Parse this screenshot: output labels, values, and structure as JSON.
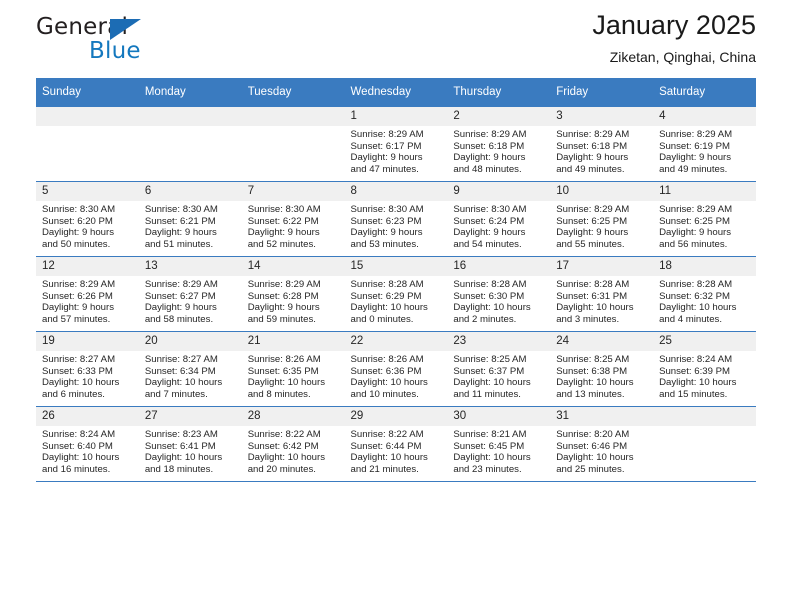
{
  "brand": {
    "name_top": "General",
    "name_bottom": "Blue",
    "triangle_color": "#1c6cb4",
    "blue_text_color": "#1478be"
  },
  "header": {
    "title": "January 2025",
    "location": "Ziketan, Qinghai, China"
  },
  "theme": {
    "header_bar_color": "#3a7bc0",
    "daynum_bg": "#f0f0f0",
    "text_color": "#262626"
  },
  "weekdays": [
    "Sunday",
    "Monday",
    "Tuesday",
    "Wednesday",
    "Thursday",
    "Friday",
    "Saturday"
  ],
  "weeks": [
    [
      {
        "day": "",
        "sunrise": "",
        "sunset": "",
        "daylight_line1": "",
        "daylight_line2": ""
      },
      {
        "day": "",
        "sunrise": "",
        "sunset": "",
        "daylight_line1": "",
        "daylight_line2": ""
      },
      {
        "day": "",
        "sunrise": "",
        "sunset": "",
        "daylight_line1": "",
        "daylight_line2": ""
      },
      {
        "day": "1",
        "sunrise": "Sunrise: 8:29 AM",
        "sunset": "Sunset: 6:17 PM",
        "daylight_line1": "Daylight: 9 hours",
        "daylight_line2": "and 47 minutes."
      },
      {
        "day": "2",
        "sunrise": "Sunrise: 8:29 AM",
        "sunset": "Sunset: 6:18 PM",
        "daylight_line1": "Daylight: 9 hours",
        "daylight_line2": "and 48 minutes."
      },
      {
        "day": "3",
        "sunrise": "Sunrise: 8:29 AM",
        "sunset": "Sunset: 6:18 PM",
        "daylight_line1": "Daylight: 9 hours",
        "daylight_line2": "and 49 minutes."
      },
      {
        "day": "4",
        "sunrise": "Sunrise: 8:29 AM",
        "sunset": "Sunset: 6:19 PM",
        "daylight_line1": "Daylight: 9 hours",
        "daylight_line2": "and 49 minutes."
      }
    ],
    [
      {
        "day": "5",
        "sunrise": "Sunrise: 8:30 AM",
        "sunset": "Sunset: 6:20 PM",
        "daylight_line1": "Daylight: 9 hours",
        "daylight_line2": "and 50 minutes."
      },
      {
        "day": "6",
        "sunrise": "Sunrise: 8:30 AM",
        "sunset": "Sunset: 6:21 PM",
        "daylight_line1": "Daylight: 9 hours",
        "daylight_line2": "and 51 minutes."
      },
      {
        "day": "7",
        "sunrise": "Sunrise: 8:30 AM",
        "sunset": "Sunset: 6:22 PM",
        "daylight_line1": "Daylight: 9 hours",
        "daylight_line2": "and 52 minutes."
      },
      {
        "day": "8",
        "sunrise": "Sunrise: 8:30 AM",
        "sunset": "Sunset: 6:23 PM",
        "daylight_line1": "Daylight: 9 hours",
        "daylight_line2": "and 53 minutes."
      },
      {
        "day": "9",
        "sunrise": "Sunrise: 8:30 AM",
        "sunset": "Sunset: 6:24 PM",
        "daylight_line1": "Daylight: 9 hours",
        "daylight_line2": "and 54 minutes."
      },
      {
        "day": "10",
        "sunrise": "Sunrise: 8:29 AM",
        "sunset": "Sunset: 6:25 PM",
        "daylight_line1": "Daylight: 9 hours",
        "daylight_line2": "and 55 minutes."
      },
      {
        "day": "11",
        "sunrise": "Sunrise: 8:29 AM",
        "sunset": "Sunset: 6:25 PM",
        "daylight_line1": "Daylight: 9 hours",
        "daylight_line2": "and 56 minutes."
      }
    ],
    [
      {
        "day": "12",
        "sunrise": "Sunrise: 8:29 AM",
        "sunset": "Sunset: 6:26 PM",
        "daylight_line1": "Daylight: 9 hours",
        "daylight_line2": "and 57 minutes."
      },
      {
        "day": "13",
        "sunrise": "Sunrise: 8:29 AM",
        "sunset": "Sunset: 6:27 PM",
        "daylight_line1": "Daylight: 9 hours",
        "daylight_line2": "and 58 minutes."
      },
      {
        "day": "14",
        "sunrise": "Sunrise: 8:29 AM",
        "sunset": "Sunset: 6:28 PM",
        "daylight_line1": "Daylight: 9 hours",
        "daylight_line2": "and 59 minutes."
      },
      {
        "day": "15",
        "sunrise": "Sunrise: 8:28 AM",
        "sunset": "Sunset: 6:29 PM",
        "daylight_line1": "Daylight: 10 hours",
        "daylight_line2": "and 0 minutes."
      },
      {
        "day": "16",
        "sunrise": "Sunrise: 8:28 AM",
        "sunset": "Sunset: 6:30 PM",
        "daylight_line1": "Daylight: 10 hours",
        "daylight_line2": "and 2 minutes."
      },
      {
        "day": "17",
        "sunrise": "Sunrise: 8:28 AM",
        "sunset": "Sunset: 6:31 PM",
        "daylight_line1": "Daylight: 10 hours",
        "daylight_line2": "and 3 minutes."
      },
      {
        "day": "18",
        "sunrise": "Sunrise: 8:28 AM",
        "sunset": "Sunset: 6:32 PM",
        "daylight_line1": "Daylight: 10 hours",
        "daylight_line2": "and 4 minutes."
      }
    ],
    [
      {
        "day": "19",
        "sunrise": "Sunrise: 8:27 AM",
        "sunset": "Sunset: 6:33 PM",
        "daylight_line1": "Daylight: 10 hours",
        "daylight_line2": "and 6 minutes."
      },
      {
        "day": "20",
        "sunrise": "Sunrise: 8:27 AM",
        "sunset": "Sunset: 6:34 PM",
        "daylight_line1": "Daylight: 10 hours",
        "daylight_line2": "and 7 minutes."
      },
      {
        "day": "21",
        "sunrise": "Sunrise: 8:26 AM",
        "sunset": "Sunset: 6:35 PM",
        "daylight_line1": "Daylight: 10 hours",
        "daylight_line2": "and 8 minutes."
      },
      {
        "day": "22",
        "sunrise": "Sunrise: 8:26 AM",
        "sunset": "Sunset: 6:36 PM",
        "daylight_line1": "Daylight: 10 hours",
        "daylight_line2": "and 10 minutes."
      },
      {
        "day": "23",
        "sunrise": "Sunrise: 8:25 AM",
        "sunset": "Sunset: 6:37 PM",
        "daylight_line1": "Daylight: 10 hours",
        "daylight_line2": "and 11 minutes."
      },
      {
        "day": "24",
        "sunrise": "Sunrise: 8:25 AM",
        "sunset": "Sunset: 6:38 PM",
        "daylight_line1": "Daylight: 10 hours",
        "daylight_line2": "and 13 minutes."
      },
      {
        "day": "25",
        "sunrise": "Sunrise: 8:24 AM",
        "sunset": "Sunset: 6:39 PM",
        "daylight_line1": "Daylight: 10 hours",
        "daylight_line2": "and 15 minutes."
      }
    ],
    [
      {
        "day": "26",
        "sunrise": "Sunrise: 8:24 AM",
        "sunset": "Sunset: 6:40 PM",
        "daylight_line1": "Daylight: 10 hours",
        "daylight_line2": "and 16 minutes."
      },
      {
        "day": "27",
        "sunrise": "Sunrise: 8:23 AM",
        "sunset": "Sunset: 6:41 PM",
        "daylight_line1": "Daylight: 10 hours",
        "daylight_line2": "and 18 minutes."
      },
      {
        "day": "28",
        "sunrise": "Sunrise: 8:22 AM",
        "sunset": "Sunset: 6:42 PM",
        "daylight_line1": "Daylight: 10 hours",
        "daylight_line2": "and 20 minutes."
      },
      {
        "day": "29",
        "sunrise": "Sunrise: 8:22 AM",
        "sunset": "Sunset: 6:44 PM",
        "daylight_line1": "Daylight: 10 hours",
        "daylight_line2": "and 21 minutes."
      },
      {
        "day": "30",
        "sunrise": "Sunrise: 8:21 AM",
        "sunset": "Sunset: 6:45 PM",
        "daylight_line1": "Daylight: 10 hours",
        "daylight_line2": "and 23 minutes."
      },
      {
        "day": "31",
        "sunrise": "Sunrise: 8:20 AM",
        "sunset": "Sunset: 6:46 PM",
        "daylight_line1": "Daylight: 10 hours",
        "daylight_line2": "and 25 minutes."
      },
      {
        "day": "",
        "sunrise": "",
        "sunset": "",
        "daylight_line1": "",
        "daylight_line2": ""
      }
    ]
  ]
}
